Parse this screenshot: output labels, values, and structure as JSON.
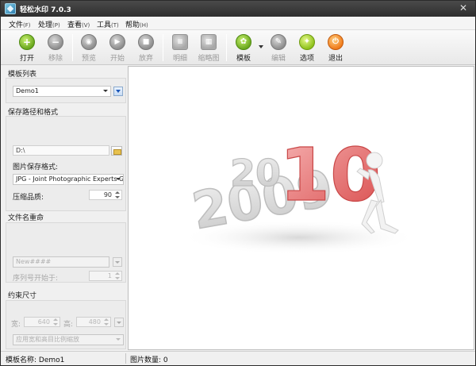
{
  "window": {
    "title": "轻松水印 7.0.3"
  },
  "menu": [
    {
      "label": "文件",
      "accel": "(F)"
    },
    {
      "label": "处理",
      "accel": "(P)"
    },
    {
      "label": "查看",
      "accel": "(V)"
    },
    {
      "label": "工具",
      "accel": "(T)"
    },
    {
      "label": "帮助",
      "accel": "(H)"
    }
  ],
  "toolbar": {
    "open": {
      "label": "打开",
      "icon": "plus-icon"
    },
    "remove": {
      "label": "移除",
      "icon": "minus-icon"
    },
    "preview": {
      "label": "预览",
      "icon": "eye-icon"
    },
    "start": {
      "label": "开始",
      "icon": "play-icon"
    },
    "abort": {
      "label": "放弃",
      "icon": "stop-icon"
    },
    "detail": {
      "label": "明细",
      "icon": "document-icon"
    },
    "thumbnail": {
      "label": "缩略图",
      "icon": "thumbnail-icon"
    },
    "template": {
      "label": "模板",
      "icon": "puzzle-icon"
    },
    "edit": {
      "label": "编辑",
      "icon": "pencil-icon"
    },
    "options": {
      "label": "选项",
      "icon": "wrench-icon"
    },
    "exit": {
      "label": "退出",
      "icon": "power-icon"
    }
  },
  "sidebar": {
    "template_list": {
      "title": "模板列表",
      "selected": "Demo1"
    },
    "save": {
      "title": "保存路径和格式",
      "path": "D:\\",
      "format_label": "图片保存格式:",
      "format_value": "JPG - Joint Photographic Experts Gr",
      "quality_label": "压缩品质:",
      "quality_value": "90"
    },
    "rename": {
      "title": "文件名重命",
      "pattern": "New####",
      "seq_label": "序列号开始于:",
      "seq_value": "1"
    },
    "constraint": {
      "title": "约束尺寸",
      "width_label": "宽:",
      "width_value": "640",
      "height_label": "高:",
      "height_value": "480",
      "mode_value": "应用宽和高目比例缩放"
    }
  },
  "preview": {
    "year_old": "2009",
    "year_new": "2010",
    "colors": {
      "grey": "#d4d4d4",
      "red": "#e35a5a"
    }
  },
  "status": {
    "template_name_label": "模板名称:",
    "template_name_value": "Demo1",
    "image_count_label": "图片数量:",
    "image_count_value": "0"
  }
}
